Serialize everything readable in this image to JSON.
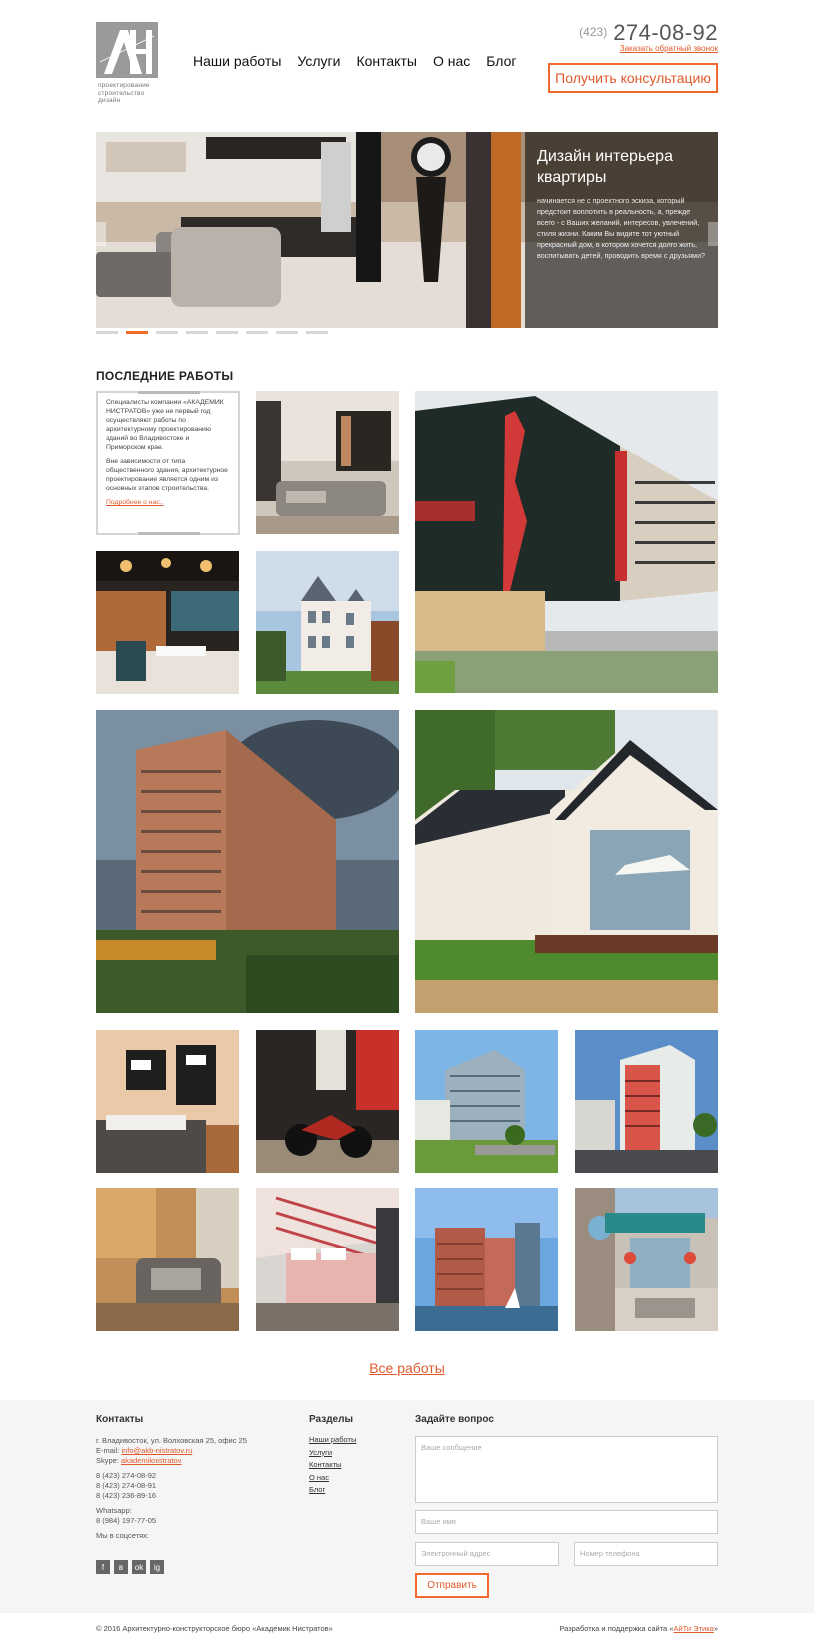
{
  "logo": {
    "letters": "АН",
    "subtitle": [
      "проектирование",
      "строительство",
      "дизайн"
    ]
  },
  "nav": [
    {
      "label": "Наши работы"
    },
    {
      "label": "Услуги"
    },
    {
      "label": "Контакты"
    },
    {
      "label": "О нас"
    },
    {
      "label": "Блог"
    }
  ],
  "header": {
    "phone_code": "(423)",
    "phone_number": "274-08-92",
    "callback_label": "Заказать обратный звонок",
    "consult_label": "Получить консультацию"
  },
  "slider": {
    "title": "Дизайн интерьера квартиры",
    "text": "начинается не с проектного эскиза, который предстоит воплотить в реальность, а, прежде всего - с Ваших желаний, интересов, увлечений, стиля жизни. Каким Вы видите тот уютный прекрасный дом, в котором хочется долго жить, воспитывать детей, проводить время с друзьями?",
    "dots_count": 8,
    "active_dot": 1
  },
  "works": {
    "title": "ПОСЛЕДНИЕ РАБОТЫ",
    "about_p1": "Специалисты компании «АКАДЕМИК НИСТРАТОВ» уже не первый год осуществляют работы по архитектурному проектированию зданий во Владивостоке и Приморском крае.",
    "about_p2": "Вне зависимости от типа общественного здания, архитектурное проектирование является одним из основных этапов строительства.",
    "about_more": "Подробнее о нас..",
    "all_works": "Все работы"
  },
  "footer": {
    "contacts_title": "Контакты",
    "address": "г. Владивосток, ул. Волховская 25, офис 25",
    "email_label": "E-mail:",
    "email": "info@akb-nistratov.ru",
    "skype_label": "Skype:",
    "skype": "akademiknistratov",
    "phones": [
      "8 (423) 274-08-92",
      "8 (423) 274-08-91",
      "8 (423) 236-89-16"
    ],
    "whatsapp_label": "Whatsapp:",
    "whatsapp": "8 (984) 197-77-05",
    "social_label": "Мы в соцсетях:",
    "social": [
      "f",
      "в",
      "ok",
      "ig"
    ],
    "sections_title": "Разделы",
    "sections": [
      "Наши работы",
      "Услуги",
      "Контакты",
      "О нас",
      "Блог"
    ],
    "ask_title": "Задайте вопрос",
    "message_placeholder": "Ваше сообщение",
    "name_placeholder": "Ваше имя",
    "email_placeholder": "Электронный адрес",
    "phone_placeholder": "Номер телефона",
    "send_label": "Отправить",
    "copyright": "© 2016 Архитектурно-конструкторское бюро «Академик Нистратов»",
    "dev_prefix": "Разработка и поддержка сайта «",
    "dev_link": "АйТи Этика",
    "dev_suffix": "»"
  },
  "colors": {
    "accent": "#f06a2c"
  }
}
